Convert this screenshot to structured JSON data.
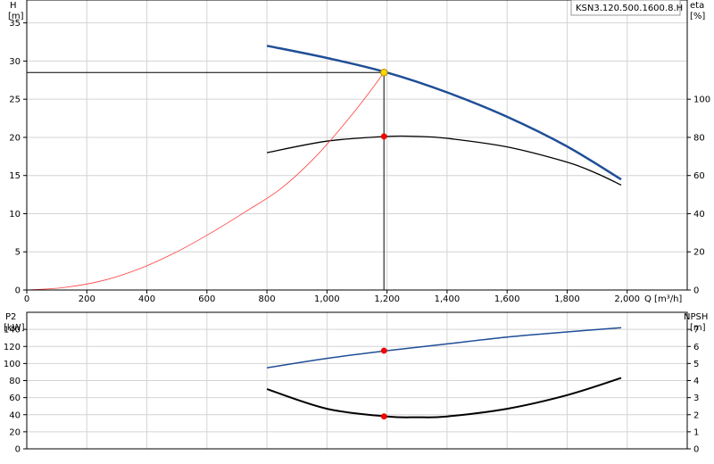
{
  "chart_data": [
    {
      "type": "line",
      "title": "KSN3.120.500.1600.8.H",
      "xlabel": "Q [m³/h]",
      "x_ticks": [
        "0",
        "200",
        "400",
        "600",
        "800",
        "1,000",
        "1,200",
        "1,400",
        "1,600",
        "1,800",
        "2,000"
      ],
      "xlim": [
        0,
        2200
      ],
      "left_axis": {
        "label_line1": "H",
        "label_line2": "[m]",
        "ylim": [
          0,
          38
        ],
        "ticks": [
          "0",
          "5",
          "10",
          "15",
          "20",
          "25",
          "30",
          "35"
        ]
      },
      "right_axis": {
        "label_line1": "eta",
        "label_line2": "[%]",
        "ylim": [
          0,
          152
        ],
        "ticks": [
          "0",
          "20",
          "40",
          "60",
          "80",
          "100"
        ]
      },
      "series": [
        {
          "key": "head",
          "axis": "left",
          "color": "#1f4e96",
          "x": [
            800,
            1000,
            1200,
            1400,
            1600,
            1800,
            1980
          ],
          "values": [
            32.0,
            30.4,
            28.5,
            25.9,
            22.7,
            18.8,
            14.5
          ]
        },
        {
          "key": "efficiency",
          "axis": "right",
          "color": "#000000",
          "x": [
            800,
            1000,
            1200,
            1300,
            1400,
            1600,
            1800,
            1900,
            1980
          ],
          "values": [
            72.0,
            78.0,
            80.5,
            80.5,
            79.5,
            75.0,
            67.0,
            61.0,
            55.0
          ]
        },
        {
          "key": "system-curve",
          "axis": "left",
          "color": "#ff4040",
          "x": [
            0,
            120,
            250,
            370,
            490,
            610,
            730,
            850,
            970,
            1090,
            1190
          ],
          "values": [
            0,
            0.3,
            1.2,
            2.7,
            4.8,
            7.4,
            10.3,
            13.4,
            17.8,
            23.3,
            28.5
          ]
        }
      ],
      "operating_point": {
        "x": 1190,
        "head": 28.5,
        "efficiency": 80.5
      }
    },
    {
      "type": "line",
      "xlim": [
        0,
        2200
      ],
      "left_axis": {
        "label_line1": "P2",
        "label_line2": "[kW]",
        "ylim": [
          0,
          160
        ],
        "ticks": [
          "0",
          "20",
          "40",
          "60",
          "80",
          "100",
          "120",
          "140"
        ]
      },
      "right_axis": {
        "label_line1": "NPSH",
        "label_line2": "[m]",
        "ylim": [
          0,
          8
        ],
        "ticks": [
          "0",
          "1",
          "2",
          "3",
          "4",
          "5",
          "6",
          "7"
        ]
      },
      "series": [
        {
          "key": "power",
          "axis": "left",
          "color": "#1f4e96",
          "x": [
            800,
            1000,
            1200,
            1400,
            1600,
            1800,
            1980
          ],
          "values": [
            95,
            106,
            115,
            123,
            131,
            137,
            142
          ]
        },
        {
          "key": "npsh",
          "axis": "right",
          "color": "#000000",
          "x": [
            800,
            1000,
            1200,
            1300,
            1400,
            1600,
            1800,
            1980
          ],
          "values": [
            3.5,
            2.35,
            1.9,
            1.85,
            1.9,
            2.35,
            3.15,
            4.15
          ]
        }
      ],
      "operating_point": {
        "x": 1190,
        "power": 115,
        "npsh": 1.9
      }
    }
  ]
}
